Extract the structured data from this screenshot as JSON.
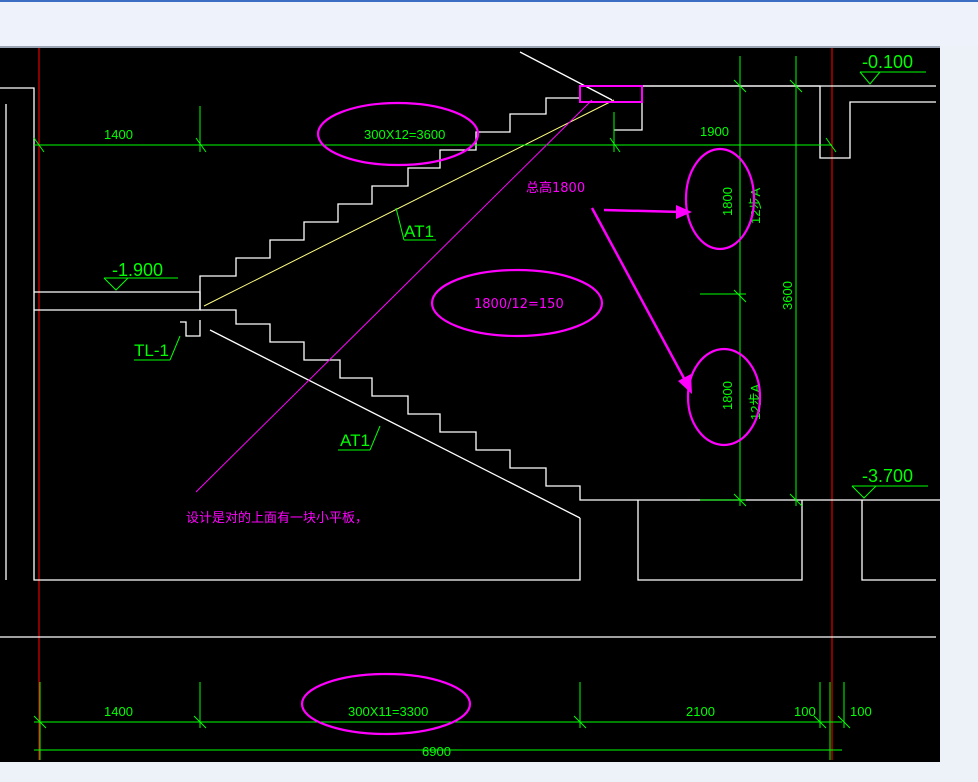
{
  "drawing": {
    "colors": {
      "background": "#000000",
      "dimension": "#00ff00",
      "outline": "#ffffff",
      "axis": "#e00000",
      "annotation": "#ff00ff",
      "stair_line": "#ffff80"
    },
    "elevations": {
      "top_right": "-0.100",
      "left": "-1.900",
      "bottom_right": "-3.700"
    },
    "top_dimensions": {
      "left": "1400",
      "stairs": "300X12=3600",
      "right": "1900"
    },
    "bottom_dimensions": {
      "left": "1400",
      "stairs": "300X11=3300",
      "right": "2100",
      "gap1": "100",
      "gap2": "100",
      "overall": "6900"
    },
    "vertical_dimensions": {
      "upper": "1800",
      "upper_steps": "12步A",
      "lower": "1800",
      "lower_steps": "12步A",
      "total": "3600"
    },
    "labels": {
      "upper_flight": "AT1",
      "lower_flight": "AT1",
      "beam": "TL-1"
    },
    "annotations": {
      "total_height": "总高1800",
      "riser_calc": "1800/12=150",
      "comment": "设计是对的上面有一块小平板，"
    }
  }
}
